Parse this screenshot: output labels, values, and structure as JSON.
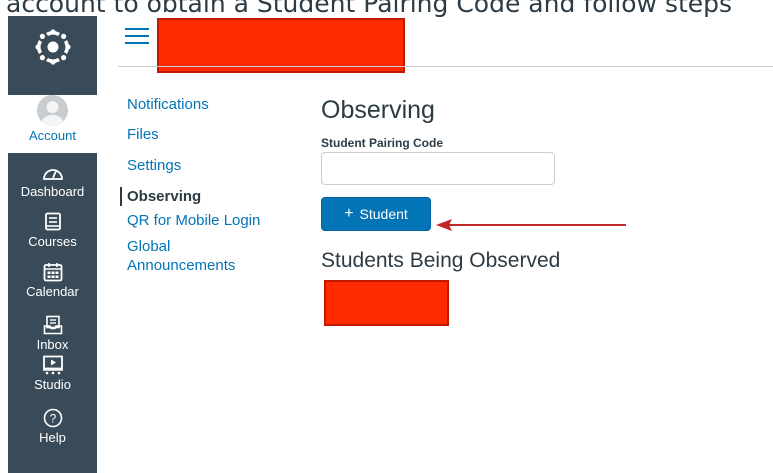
{
  "caption": "account to obtain a Student Pairing Code and follow steps",
  "global_nav": {
    "account_label": "Account",
    "items": [
      {
        "label": "Dashboard",
        "icon": "dashboard-icon"
      },
      {
        "label": "Courses",
        "icon": "courses-icon"
      },
      {
        "label": "Calendar",
        "icon": "calendar-icon"
      },
      {
        "label": "Inbox",
        "icon": "inbox-icon"
      },
      {
        "label": "Studio",
        "icon": "studio-icon"
      },
      {
        "label": "Help",
        "icon": "help-icon"
      }
    ]
  },
  "account_nav": {
    "items": [
      {
        "label": "Notifications"
      },
      {
        "label": "Files"
      },
      {
        "label": "Settings"
      },
      {
        "label": "Observing",
        "active": true
      },
      {
        "label": "QR for Mobile Login"
      },
      {
        "label": "Global Announcements"
      }
    ]
  },
  "main": {
    "title": "Observing",
    "pairing_label": "Student Pairing Code",
    "pairing_value": "",
    "add_button_label": "Student",
    "students_heading": "Students Being Observed"
  },
  "colors": {
    "nav_bg": "#394b58",
    "link": "#0374b5",
    "button": "#0374b5",
    "redaction": "#ff2a00",
    "annotation_arrow": "#c0282a"
  }
}
